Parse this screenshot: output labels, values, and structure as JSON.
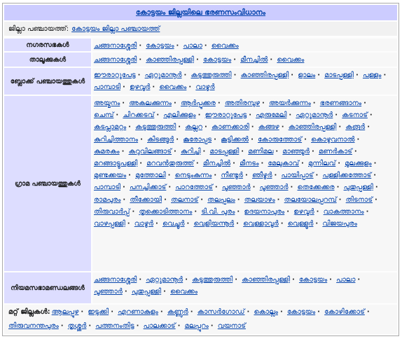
{
  "title": "കോട്ടയം ജില്ലയിലെ ഭരണസംവിധാനം",
  "district_panchayat": {
    "label": "ജില്ലാ പഞ്ചായത്ത്:",
    "value": "കോട്ടയം ജില്ലാ പഞ്ചായത്ത്"
  },
  "groups": [
    {
      "label": "നഗരസഭകൾ",
      "items": [
        "ചങ്ങനാശ്ശേരി",
        "കോട്ടയം",
        "പാലാ",
        "വൈക്കം"
      ]
    },
    {
      "label": "താലൂക്കുകൾ",
      "items": [
        "ചങ്ങനാശ്ശേരി",
        "കാഞ്ഞിരപ്പള്ളി",
        "കോട്ടയം",
        "മീനച്ചിൽ",
        "വൈക്കം"
      ]
    },
    {
      "label": "ബ്ലോക്ക് പഞ്ചായത്തുകൾ",
      "items": [
        "ഈരാറ്റുപേട്ട",
        "ഏറ്റുമാനൂർ",
        "കടുത്തുരുത്തി",
        "കാഞ്ഞിരപ്പള്ളി",
        "ളാലം",
        "മാടപ്പള്ളി",
        "പള്ളം",
        "പാമ്പാടി",
        "ഉഴവൂർ",
        "വൈക്കം",
        "വാഴൂർ"
      ]
    },
    {
      "label": "ഗ്രാമ പഞ്ചായത്തുകൾ",
      "items": [
        "അയ്മനം",
        "അകലക്കുന്നം",
        "ആർപ്പൂക്കര",
        "അതിരമ്പുഴ",
        "അയർക്കുന്നം",
        "ഭരണങ്ങാനം",
        "ചെമ്പ്",
        "ചിറക്കടവ്",
        "എലിക്കുളം",
        "ഈരാറ്റുപേട്ട",
        "എരുമേലി",
        "ഏറ്റുമാനൂർ",
        "കടനാട്",
        "കടപ്ലാമറ്റം",
        "കടുത്തുരുത്തി",
        "കല്ലറ",
        "കാണക്കാരി",
        "കങ്ങഴ",
        "കാഞ്ഞിരപ്പള്ളി",
        "കരൂർ",
        "കുറിച്ചിത്താനം",
        "കിടങ്ങൂർ",
        "കൂരോപ്പട",
        "കൂട്ടിക്കൽ",
        "കോരുത്തോട്",
        "കൊഴുവനാൽ",
        "കുമരകം",
        "കറുവിലങ്ങാട്",
        "കുറിച്ചി",
        "മാടപ്പള്ളി",
        "മണിമല",
        "മാഞ്ഞൂർ",
        "മണർകാട്",
        "മറങ്ങാട്ടുപള്ളി",
        "മറവൻതുരുത്ത്",
        "മീനച്ചിൽ",
        "മീനടം",
        "മേലുകാവ്",
        "മുന്നിലവ്",
        "മൂലക്കുളം",
        "മുണ്ടക്കയം",
        "മുത്തോലി",
        "നെടുംകുന്നം",
        "നീണ്ടൂർ",
        "ഞീഴൂർ",
        "പായിപ്പാട്",
        "പള്ളിക്കത്തോട്",
        "പാമ്പാടി",
        "പനച്ചിക്കാട്",
        "പാറത്തോട്",
        "പൂഞ്ഞാർ",
        "പൂഞ്ഞാർ",
        "തെക്കേക്കര",
        "പുതുപ്പള്ളി",
        "രാമപുരം",
        "തീക്കോയി",
        "തലനാട്",
        "തലപ്പലം",
        "തലയാഴം",
        "തലയോലപ്പറമ്പ്",
        "തിടനാട്",
        "തിരുവാർപ്പ്",
        "തൃക്കൊടിത്താനം",
        "ടി.വി. പുരം",
        "ഉദയനാപുരം",
        "ഉഴവൂർ",
        "വാകത്താനം",
        "വാഴപ്പള്ളി",
        "വാഴൂർ",
        "വെച്ചൂർ",
        "വെളിയന്നൂർ",
        "വെള്ളാവൂർ",
        "വെള്ളൂർ",
        "വിജയപുരം"
      ]
    },
    {
      "label": "നിയമസഭാമണ്ഡലങ്ങൾ",
      "items": [
        "ചങ്ങനാശ്ശേരി",
        "ഏറ്റുമാനൂർ",
        "കടുത്തുരുത്തി",
        "കാഞ്ഞിരപ്പള്ളി",
        "കോട്ടയം",
        "പാലാ",
        "പൂഞ്ഞാർ",
        "പുതുപ്പള്ളി",
        "വൈക്കം"
      ]
    }
  ],
  "other_districts": {
    "label": "മറ്റ് ജില്ലകൾ:",
    "items": [
      "ആലപ്പുഴ",
      "ഇടുക്കി",
      "എറണാകുളം",
      "കണ്ണൂർ",
      "കാസർഗോഡ്",
      "കൊല്ലം",
      "കോട്ടയം",
      "കോഴിക്കോട്",
      "തിരുവനന്തപുരം",
      "തൃശ്ശൂർ",
      "പത്തനംതിട്ട",
      "പാലക്കാട്",
      "മലപ്പുറം",
      "വയനാട്"
    ]
  },
  "separator": "·"
}
